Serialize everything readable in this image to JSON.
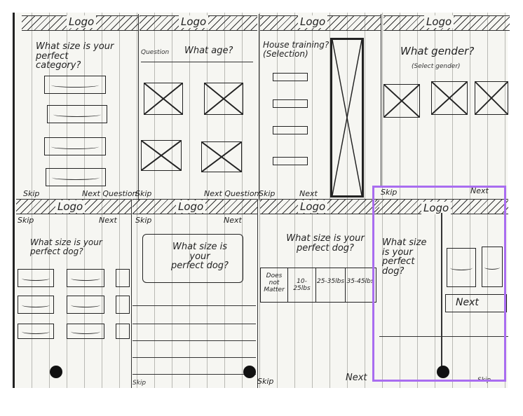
{
  "logo": "Logo",
  "panels": {
    "p1": {
      "question": "What size is your perfect\ncategory?",
      "skip": "Skip",
      "next": "Next Question"
    },
    "p2": {
      "sub": "Question",
      "question": "What age?",
      "skip": "Skip",
      "next": "Next Question"
    },
    "p3": {
      "question": "House training?\n(Selection)",
      "skip": "Skip",
      "next": "Next"
    },
    "p4": {
      "question": "What gender?",
      "sub": "(Select gender)"
    },
    "p5": {
      "skip": "Skip",
      "next": "Next",
      "question": "What size is your\nperfect dog?"
    },
    "p6": {
      "skip": "Skip",
      "next": "Next",
      "question": "What size is\nyour\nperfect dog?",
      "footer": "Skip"
    },
    "p7": {
      "question": "What size is your\nperfect dog?",
      "size_options": [
        "Does not Matter",
        "10-25lbs",
        "25-35lbs",
        "35-45lbs"
      ],
      "skip": "Skip",
      "next": "Next"
    },
    "p8": {
      "skip": "Skip",
      "next": "Next",
      "question": "What size\nis your\nperfect\ndog?",
      "next_button": "Next",
      "footer": "Skip"
    }
  },
  "colors": {
    "highlight": "#a96df0",
    "ink": "#222222",
    "paper": "#f6f6f2"
  }
}
